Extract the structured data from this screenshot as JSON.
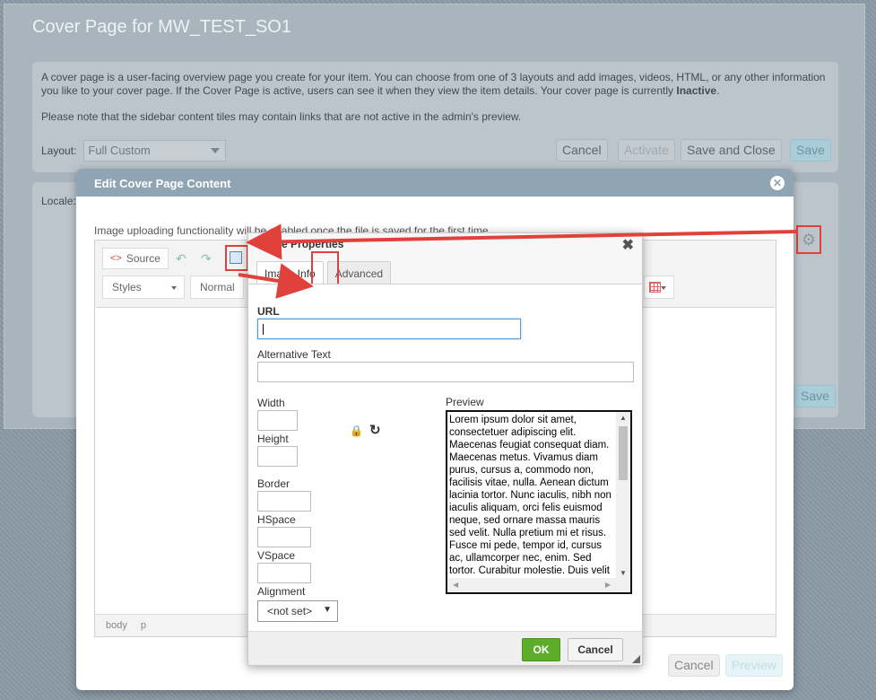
{
  "page": {
    "title": "Cover Page for MW_TEST_SO1",
    "intro_text": "A cover page is a user-facing overview page you create for your item. You can choose from one of 3 layouts and add images, videos, HTML, or any other information you like to your cover page. If the Cover Page is active, users can see it when they view the item details. Your cover page is currently ",
    "intro_status": "Inactive",
    "intro_period": ".",
    "sidebar_note": "Please note that the sidebar content tiles may contain links that are not active in the admin's preview.",
    "layout_label": "Layout:",
    "layout_value": "Full Custom",
    "buttons": {
      "cancel": "Cancel",
      "activate": "Activate",
      "save_close": "Save and Close",
      "save": "Save"
    },
    "locale_label": "Locale:",
    "locale_save": "Save",
    "gear_icon": "gear-icon"
  },
  "edit_dialog": {
    "title": "Edit Cover Page Content",
    "upload_note": "Image uploading functionality will be enabled once the file is saved for the first time.",
    "toolbar": {
      "source": "Source",
      "styles": "Styles",
      "format": "Normal"
    },
    "status_path": [
      "body",
      "p"
    ],
    "cancel": "Cancel",
    "preview": "Preview"
  },
  "image_dialog": {
    "title": "Image Properties",
    "tabs": [
      {
        "label": "Image Info",
        "active": true
      },
      {
        "label": "Advanced",
        "active": false
      }
    ],
    "fields": {
      "url_label": "URL",
      "url_value": "",
      "alt_label": "Alternative Text",
      "alt_value": "",
      "width_label": "Width",
      "height_label": "Height",
      "border_label": "Border",
      "hspace_label": "HSpace",
      "vspace_label": "VSpace",
      "alignment_label": "Alignment",
      "alignment_value": "<not set>"
    },
    "preview_label": "Preview",
    "preview_text": "Lorem ipsum dolor sit amet, consectetuer adipiscing elit. Maecenas feugiat consequat diam. Maecenas metus. Vivamus diam purus, cursus a, commodo non, facilisis vitae, nulla. Aenean dictum lacinia tortor. Nunc iaculis, nibh non iaculis aliquam, orci felis euismod neque, sed ornare massa mauris sed velit. Nulla pretium mi et risus. Fusce mi pede, tempor id, cursus ac, ullamcorper nec, enim. Sed tortor. Curabitur molestie. Duis velit augue, condimentum at, ultrices a, luctus ut, orci.",
    "ok": "OK",
    "cancel": "Cancel"
  },
  "colors": {
    "annotation": "#e0413a",
    "ok_green": "#5cae2a",
    "dialog_header": "#8fa5b3"
  }
}
